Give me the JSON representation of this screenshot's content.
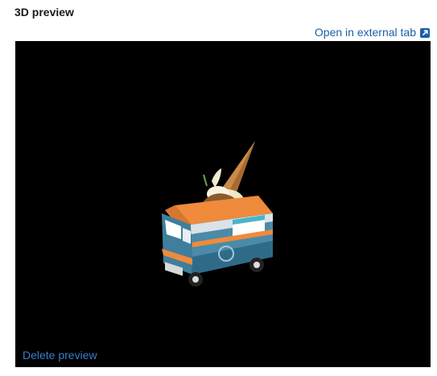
{
  "section": {
    "title": "3D preview"
  },
  "actions": {
    "open_external_label": "Open in external tab",
    "open_external_icon": "external-link-icon",
    "delete_label": "Delete preview"
  },
  "viewer": {
    "background": "#000000",
    "model": "ice-cream-truck-model"
  },
  "colors": {
    "link": "#1a5fa8",
    "truck_body": "#4b8aa8",
    "truck_orange": "#f08a3c",
    "cone": "#c98a4a"
  }
}
